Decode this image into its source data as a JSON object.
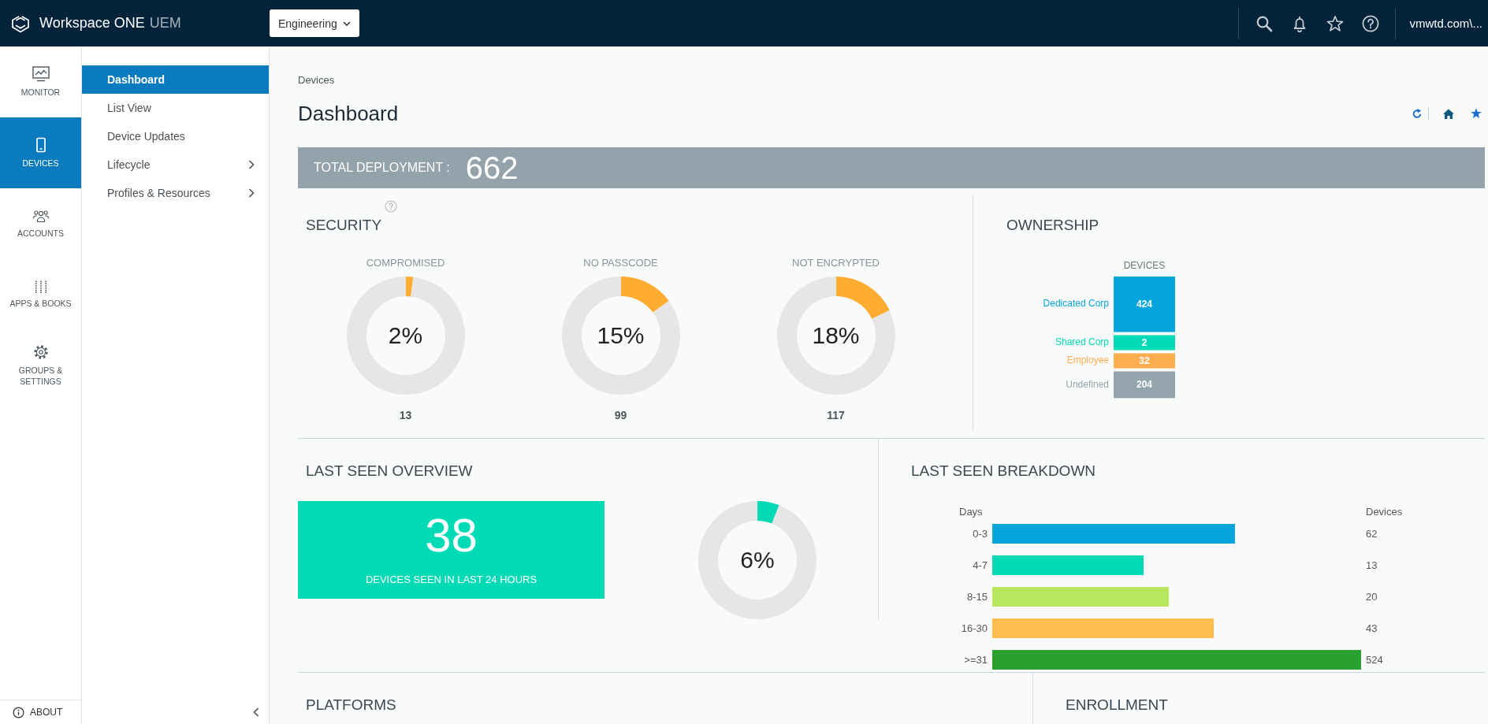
{
  "topbar": {
    "product": "Workspace ONE",
    "edition": "UEM",
    "org_selector": "Engineering",
    "user": "vmwtd.com\\..."
  },
  "rail": {
    "items": [
      {
        "label": "MONITOR",
        "selected": false
      },
      {
        "label": "DEVICES",
        "selected": true
      },
      {
        "label": "ACCOUNTS",
        "selected": false
      },
      {
        "label": "APPS & BOOKS",
        "selected": false
      },
      {
        "label": "GROUPS & SETTINGS",
        "selected": false
      }
    ],
    "about": "ABOUT"
  },
  "subnav": {
    "items": [
      {
        "label": "Dashboard",
        "selected": true,
        "has_submenu": false
      },
      {
        "label": "List View",
        "selected": false,
        "has_submenu": false
      },
      {
        "label": "Device Updates",
        "selected": false,
        "has_submenu": false
      },
      {
        "label": "Lifecycle",
        "selected": false,
        "has_submenu": true
      },
      {
        "label": "Profiles & Resources",
        "selected": false,
        "has_submenu": true
      }
    ]
  },
  "page": {
    "breadcrumb": "Devices",
    "title": "Dashboard"
  },
  "total_deployment": {
    "label": "TOTAL DEPLOYMENT :",
    "value": "662"
  },
  "security": {
    "title": "SECURITY",
    "metrics": [
      {
        "label": "COMPROMISED",
        "percent": "2%",
        "count": "13",
        "chart_data": {
          "type": "donut",
          "values": [
            2,
            98
          ]
        }
      },
      {
        "label": "NO PASSCODE",
        "percent": "15%",
        "count": "99",
        "chart_data": {
          "type": "donut",
          "values": [
            15,
            85
          ]
        }
      },
      {
        "label": "NOT ENCRYPTED",
        "percent": "18%",
        "count": "117",
        "chart_data": {
          "type": "donut",
          "values": [
            18,
            82
          ]
        }
      }
    ]
  },
  "ownership": {
    "title": "OWNERSHIP",
    "column_header": "DEVICES",
    "segments": [
      {
        "label": "Dedicated Corp",
        "count": "424",
        "color": "#04a4dc"
      },
      {
        "label": "Shared Corp",
        "count": "2",
        "color": "#00dab5"
      },
      {
        "label": "Employee",
        "count": "32",
        "color": "#ffae4f"
      },
      {
        "label": "Undefined",
        "count": "204",
        "color": "#94a5ad"
      }
    ]
  },
  "last_seen_overview": {
    "title": "LAST SEEN OVERVIEW",
    "count": "38",
    "caption": "DEVICES SEEN IN LAST 24 HOURS",
    "percent": "6%",
    "chart_data": {
      "type": "donut",
      "values": [
        6,
        94
      ]
    }
  },
  "last_seen_breakdown": {
    "title": "LAST SEEN BREAKDOWN",
    "days_header": "Days",
    "devices_header": "Devices",
    "rows": [
      {
        "days": "0-3",
        "devices": "62",
        "color": "#04a4dc"
      },
      {
        "days": "4-7",
        "devices": "13",
        "color": "#00dab5"
      },
      {
        "days": "8-15",
        "devices": "20",
        "color": "#b8e65c"
      },
      {
        "days": "16-30",
        "devices": "43",
        "color": "#ffbe4f"
      },
      {
        "days": ">=31",
        "devices": "524",
        "color": "#2aa02e"
      }
    ]
  },
  "platforms": {
    "title": "PLATFORMS"
  },
  "enrollment": {
    "title": "ENROLLMENT"
  }
}
